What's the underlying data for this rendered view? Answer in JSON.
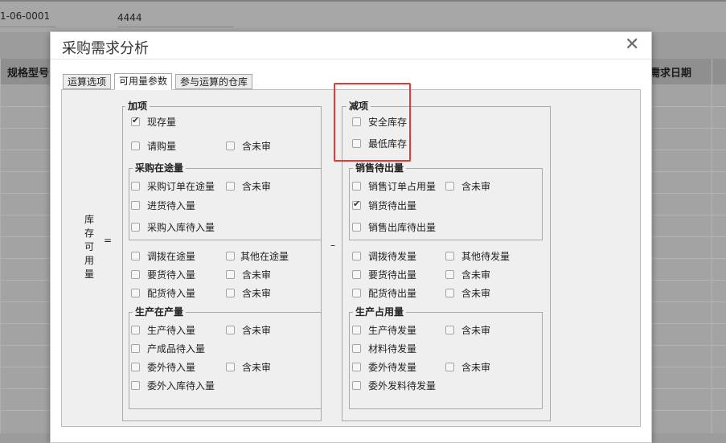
{
  "background": {
    "doc_code": "1-06-0001",
    "field_value": "4444",
    "col_left_header": "规格型号",
    "col_right_header": "需求日期"
  },
  "dialog": {
    "title": "采购需求分析",
    "close_glyph": "✕",
    "tabs": [
      {
        "label": "运算选项",
        "active": false
      },
      {
        "label": "可用量参数",
        "active": true
      },
      {
        "label": "参与运算的仓库",
        "active": false
      }
    ],
    "formula": {
      "vertical_label": [
        "库",
        "存",
        "可",
        "用",
        "量"
      ],
      "equals": "=",
      "minus": "–"
    },
    "add_group": {
      "title": "加项",
      "items": [
        {
          "label": "现存量",
          "checked": true
        },
        {
          "label": "请购量",
          "checked": false
        },
        {
          "label": "含未审",
          "checked": false
        },
        {
          "label": "调拨在途量",
          "checked": false
        },
        {
          "label": "其他在途量",
          "checked": false
        },
        {
          "label": "要货待入量",
          "checked": false
        },
        {
          "label": "含未审",
          "checked": false
        },
        {
          "label": "配货待入量",
          "checked": false
        },
        {
          "label": "含未审",
          "checked": false
        }
      ],
      "purchase": {
        "title": "采购在途量",
        "items": [
          {
            "label": "采购订单在途量",
            "checked": false
          },
          {
            "label": "含未审",
            "checked": false
          },
          {
            "label": "进货待入量",
            "checked": false
          },
          {
            "label": "采购入库待入量",
            "checked": false
          }
        ]
      },
      "production": {
        "title": "生产在产量",
        "items": [
          {
            "label": "生产待入量",
            "checked": false
          },
          {
            "label": "含未审",
            "checked": false
          },
          {
            "label": "产成品待入量",
            "checked": false
          },
          {
            "label": "委外待入量",
            "checked": false
          },
          {
            "label": "含未审",
            "checked": false
          },
          {
            "label": "委外入库待入量",
            "checked": false
          }
        ]
      }
    },
    "sub_group": {
      "title": "减项",
      "items": [
        {
          "label": "安全库存",
          "checked": false
        },
        {
          "label": "最低库存",
          "checked": false
        },
        {
          "label": "调拨待发量",
          "checked": false
        },
        {
          "label": "其他待发量",
          "checked": false
        },
        {
          "label": "要货待出量",
          "checked": false
        },
        {
          "label": "含未审",
          "checked": false
        },
        {
          "label": "配货待出量",
          "checked": false
        },
        {
          "label": "含未审",
          "checked": false
        }
      ],
      "sales": {
        "title": "销售待出量",
        "items": [
          {
            "label": "销售订单占用量",
            "checked": false
          },
          {
            "label": "含未审",
            "checked": false
          },
          {
            "label": "销货待出量",
            "checked": true
          },
          {
            "label": "销售出库待出量",
            "checked": false
          }
        ]
      },
      "production_use": {
        "title": "生产占用量",
        "items": [
          {
            "label": "生产待发量",
            "checked": false
          },
          {
            "label": "含未审",
            "checked": false
          },
          {
            "label": "材料待发量",
            "checked": false
          },
          {
            "label": "委外待发量",
            "checked": false
          },
          {
            "label": "含未审",
            "checked": false
          },
          {
            "label": "委外发料待发量",
            "checked": false
          }
        ]
      }
    },
    "colors": {
      "highlight": "#e53935"
    }
  }
}
